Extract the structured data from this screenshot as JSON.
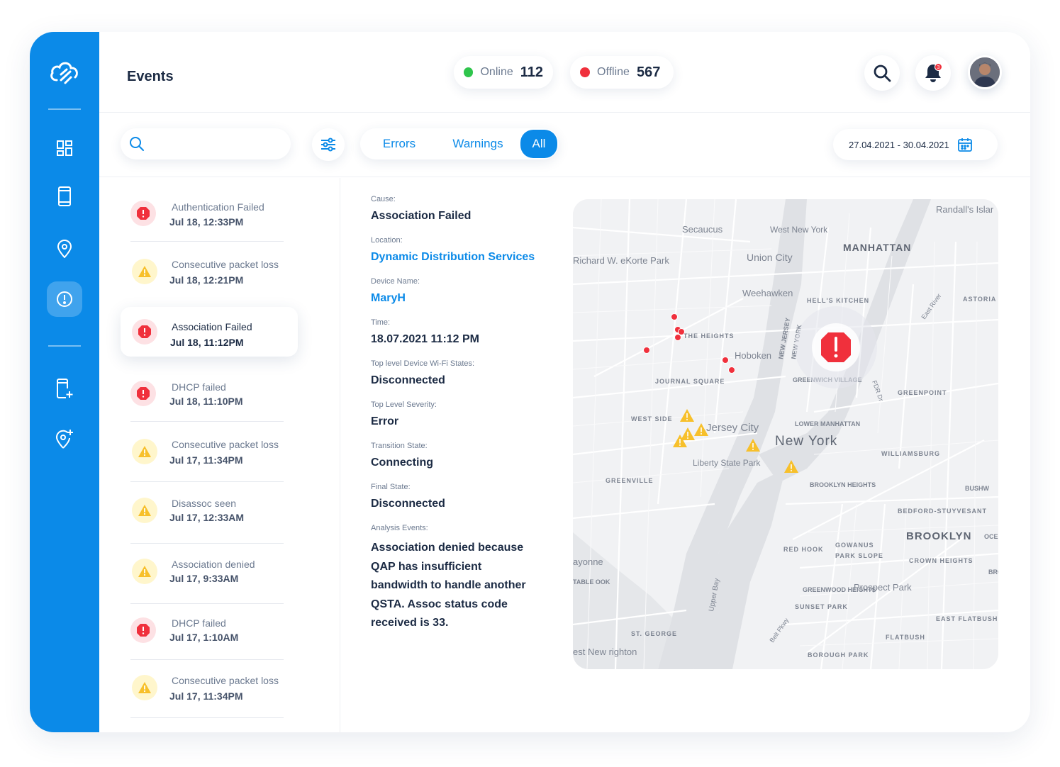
{
  "app": {
    "title": "Events"
  },
  "status": {
    "online": {
      "label": "Online",
      "count": "112",
      "color": "#2fc54c"
    },
    "offline": {
      "label": "Offline",
      "count": "567",
      "color": "#f0303c"
    }
  },
  "header": {
    "notification_count": "3"
  },
  "toolbar": {
    "search_placeholder": "",
    "tabs": [
      {
        "label": "Errors"
      },
      {
        "label": "Warnings"
      },
      {
        "label": "All"
      }
    ],
    "active_tab": "All",
    "date_range": "27.04.2021 - 30.04.2021"
  },
  "events": [
    {
      "name": "Authentication Failed",
      "time": "Jul 18, 12:33PM",
      "severity": "error"
    },
    {
      "name": "Consecutive packet loss",
      "time": "Jul 18, 12:21PM",
      "severity": "warning"
    },
    {
      "name": "Association Failed",
      "time": "Jul 18, 11:12PM",
      "severity": "error",
      "selected": true
    },
    {
      "name": "DHCP failed",
      "time": "Jul 18, 11:10PM",
      "severity": "error"
    },
    {
      "name": "Consecutive packet loss",
      "time": "Jul 17, 11:34PM",
      "severity": "warning"
    },
    {
      "name": "Disassoc seen",
      "time": "Jul 17, 12:33AM",
      "severity": "warning"
    },
    {
      "name": "Association denied",
      "time": "Jul 17, 9:33AM",
      "severity": "warning"
    },
    {
      "name": "DHCP failed",
      "time": "Jul 17, 1:10AM",
      "severity": "error"
    },
    {
      "name": "Consecutive packet loss",
      "time": "Jul 17, 11:34PM",
      "severity": "warning"
    }
  ],
  "details": [
    {
      "label": "Cause:",
      "value": "Association Failed"
    },
    {
      "label": "Location:",
      "value": "Dynamic Distribution Services",
      "link": true
    },
    {
      "label": "Device Name:",
      "value": "MaryH",
      "link": true
    },
    {
      "label": "Time:",
      "value": "18.07.2021 11:12 PM"
    },
    {
      "label": "Top level Device Wi-Fi States:",
      "value": "Disconnected"
    },
    {
      "label": "Top Level Severity:",
      "value": "Error"
    },
    {
      "label": "Transition State:",
      "value": "Connecting"
    },
    {
      "label": "Final State:",
      "value": "Disconnected"
    },
    {
      "label": "Analysis Events:",
      "value": "Association denied because QAP has insufficient bandwidth to handle another QSTA. Assoc status code received is 33."
    }
  ],
  "map": {
    "labels": [
      "Randall's Islar",
      "Secaucus",
      "West New York",
      "MANHATTAN",
      "Richard W. eKorte Park",
      "Union City",
      "Weehawken",
      "HELL'S KITCHEN",
      "ASTORIA",
      "THE HEIGHTS",
      "Hoboken",
      "NEW JERSEY",
      "NEW YORK",
      "JOURNAL SQUARE",
      "GREENWICH VILLAGE",
      "GREENPOINT",
      "WEST SIDE",
      "Jersey City",
      "LOWER MANHATTAN",
      "New York",
      "WILLIAMSBURG",
      "Liberty State Park",
      "GREENVILLE",
      "BROOKLYN HEIGHTS",
      "BUSHW",
      "BEDFORD-STUYVESANT",
      "BROOKLYN",
      "OCE",
      "RED HOOK",
      "GOWANUS",
      "PARK SLOPE",
      "ayonne",
      "CROWN HEIGHTS",
      "BROW",
      "TABLE OOK",
      "GREENWOOD HEIGHTS",
      "Prospect Park",
      "SUNSET PARK",
      "EAST FLATBUSH",
      "ST. GEORGE",
      "est New righton",
      "FLATBUSH",
      "BOROUGH PARK",
      "Upper Bay",
      "Belt Pkwy",
      "FDR Dr",
      "East River"
    ],
    "marker_colors": {
      "error": "#f0303c",
      "warning": "#f7c02b"
    }
  }
}
